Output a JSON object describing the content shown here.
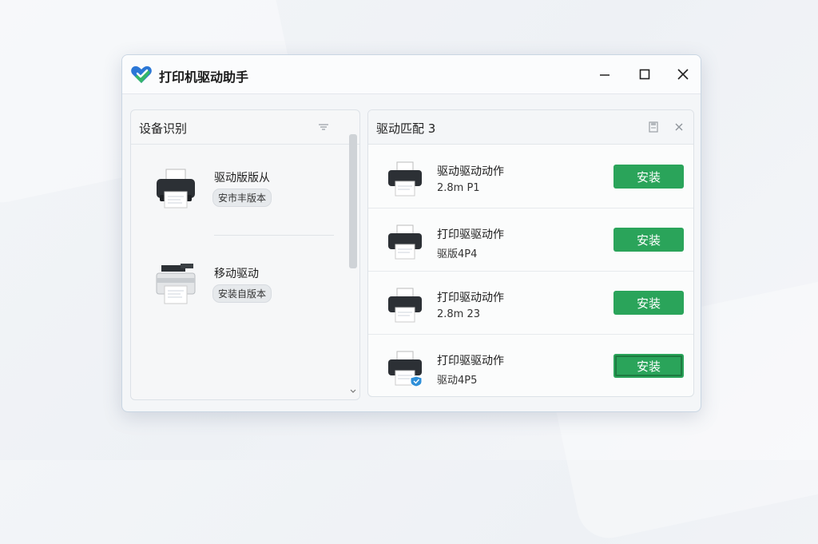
{
  "app": {
    "title": "打印机驱动助手",
    "accent": "#2aa45a"
  },
  "window_controls": [
    "minimize-icon",
    "maximize-icon",
    "close-icon"
  ],
  "left_panel": {
    "title": "设备识别",
    "devices": [
      {
        "name": "驱动版版从",
        "badge": "安市丰版本",
        "icon": "printer-icon"
      },
      {
        "name": "移动驱动",
        "badge": "安装自版本",
        "icon": "multifunction-printer-icon"
      }
    ]
  },
  "right_panel": {
    "title": "驱动匹配 3",
    "drivers": [
      {
        "name": "驱动驱动动作",
        "version": "2.8m P1",
        "button": "安装"
      },
      {
        "name": "打印驱驱动作",
        "version": "驱版4P4",
        "button": "安装"
      },
      {
        "name": "打印驱动动作",
        "version": "2.8m 23",
        "button": "安装"
      },
      {
        "name": "打印驱驱动作",
        "version": "驱动4P5",
        "button": "安装"
      }
    ]
  }
}
